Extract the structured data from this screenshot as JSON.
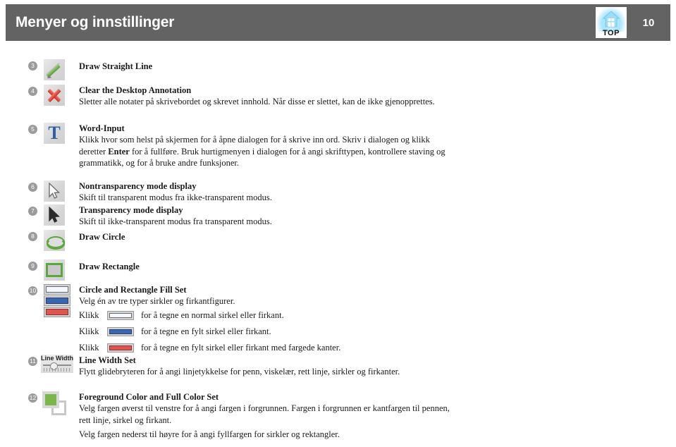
{
  "header": {
    "title": "Menyer og innstillinger",
    "page_number": "10",
    "badge_label": "TOP",
    "badge_icon": "projector-house-icon",
    "bar_color": "#636363"
  },
  "items": [
    {
      "number": "3",
      "icon": "draw-straight-line-icon",
      "title": "Draw Straight Line",
      "desc": ""
    },
    {
      "number": "4",
      "icon": "clear-annotation-x-icon",
      "title": "Clear the Desktop Annotation",
      "desc": "Sletter alle notater på skrivebordet og skrevet innhold. Når disse er slettet, kan de ikke gjenopprettes."
    },
    {
      "number": "5",
      "icon": "word-input-t-icon",
      "title": "Word-Input",
      "desc_part1": "Klikk hvor som helst på skjermen for å åpne dialogen for å skrive inn ord. Skriv i dialogen og klikk deretter ",
      "desc_bold": "Enter",
      "desc_part2": " for å fullføre. Bruk hurtigmenyen i dialogen for å angi skrifttypen, kontrollere staving og grammatikk, og for å bruke andre funksjoner."
    },
    {
      "number": "6",
      "icon": "nontransparency-cursor-icon",
      "title": "Nontransparency mode display",
      "desc": "Skift til transparent modus fra ikke-transparent modus."
    },
    {
      "number": "7",
      "icon": "transparency-cursor-icon",
      "title": "Transparency mode display",
      "desc": "Skift til ikke-transparent modus fra transparent modus."
    },
    {
      "number": "8",
      "icon": "draw-circle-icon",
      "title": "Draw Circle",
      "desc": ""
    },
    {
      "number": "9",
      "icon": "draw-rectangle-icon",
      "title": "Draw Rectangle",
      "desc": ""
    },
    {
      "number": "10",
      "icon": "fill-set-swatches-icon",
      "title": "Circle and Rectangle Fill Set",
      "desc": "Velg én av tre typer sirkler og firkantfigurer.",
      "klikk_lines": [
        {
          "label": "Klikk",
          "swatch": "outline-swatch",
          "tail": "for å tegne en normal sirkel eller firkant."
        },
        {
          "label": "Klikk",
          "swatch": "blue-filled-swatch",
          "tail": "for å tegne en fylt sirkel eller firkant."
        },
        {
          "label": "Klikk",
          "swatch": "red-filled-swatch",
          "tail": "for å tegne en fylt sirkel eller firkant med fargede kanter."
        }
      ]
    },
    {
      "number": "11",
      "icon": "line-width-slider-icon",
      "icon_text": "Line Width",
      "title": "Line Width Set",
      "desc": "Flytt glidebryteren for å angi linjetykkelse for penn, viskelær, rett linje, sirkler og firkanter."
    },
    {
      "number": "12",
      "icon": "foreground-fill-color-icon",
      "title": "Foreground Color and Full Color Set",
      "desc": "Velg fargen øverst til venstre for å angi fargen i forgrunnen. Fargen i forgrunnen er kantfargen til pennen, rett linje, sirkel og firkant.",
      "desc2": "Velg fargen nederst til høyre for å angi fyllfargen for sirkler og rektangler."
    }
  ],
  "colors": {
    "header_bar": "#636363",
    "number_badge": "#9b9b9b",
    "green_accent": "#5aa83d",
    "red_accent": "#cf2d1c",
    "blue_accent": "#3a66b0",
    "foreground_green": "#7ab648"
  }
}
